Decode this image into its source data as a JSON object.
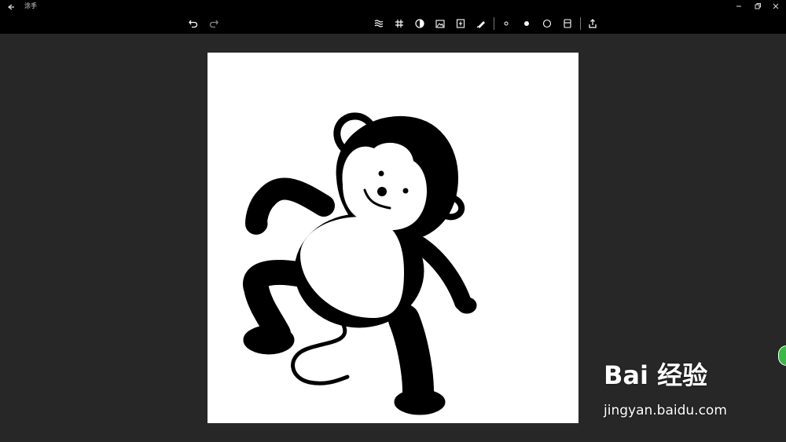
{
  "app": {
    "title": "涂手"
  },
  "toolbar": {
    "undo": "undo-icon",
    "redo": "redo-icon",
    "tools": [
      "texture-icon",
      "grid-icon",
      "contrast-icon",
      "save-image-icon",
      "export-icon",
      "brush-icon"
    ],
    "brush_sizes": [
      "small-dot-icon",
      "large-dot-icon",
      "circle-outline-icon"
    ],
    "layers": "layers-icon",
    "share": "share-icon"
  },
  "watermark": {
    "brand": "Bai 经验",
    "url": "jingyan.baidu.com"
  },
  "colors": {
    "title_bar": "#000000",
    "workspace": "#272727",
    "paper": "#ffffff",
    "ink": "#000000",
    "floating_badge": "#3fb54a"
  }
}
